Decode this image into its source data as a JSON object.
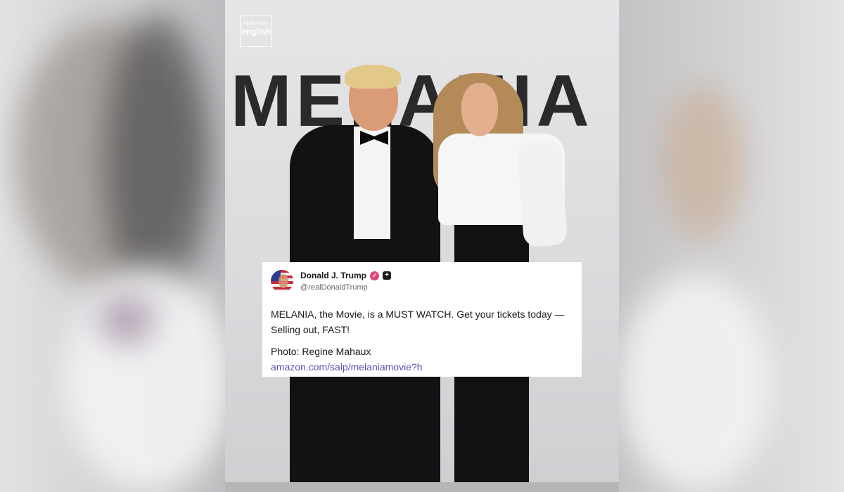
{
  "brand": {
    "logo_line1": "ALARABIYA",
    "logo_line2": "english"
  },
  "backdrop": {
    "title": "MELANIA"
  },
  "post": {
    "author_name": "Donald J. Trump",
    "author_handle": "@realDonaldTrump",
    "verified_icon": "verified-badge-icon",
    "affiliation_icon": "affiliation-badge-icon",
    "text": "MELANIA, the Movie, is a MUST WATCH. Get your tickets today — Selling out, FAST!",
    "photo_credit": "Photo: Regine Mahaux",
    "link": "amazon.com/salp/melaniamovie?h"
  },
  "colors": {
    "verified_badge": "#e0457b",
    "link": "#5d4fb3",
    "card_background": "#ffffff"
  }
}
